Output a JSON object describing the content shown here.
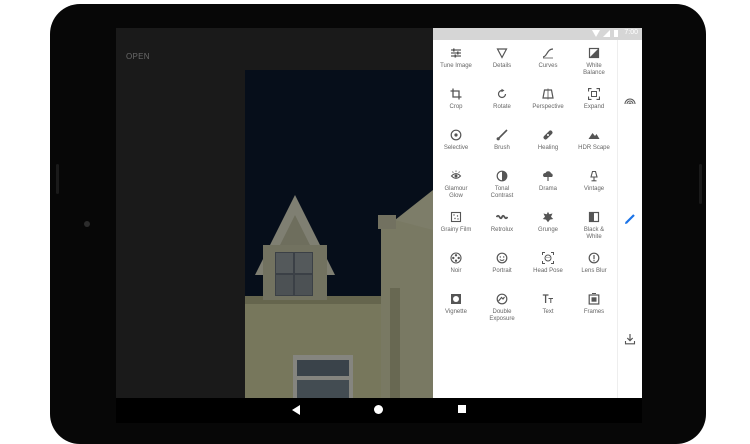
{
  "app": {
    "open_label": "OPEN"
  },
  "status_bar": {
    "time": "7:00"
  },
  "tools": [
    {
      "label": "Tune Image",
      "icon": "tune-icon"
    },
    {
      "label": "Details",
      "icon": "details-icon"
    },
    {
      "label": "Curves",
      "icon": "curves-icon"
    },
    {
      "label": "White\nBalance",
      "icon": "white-balance-icon"
    },
    {
      "label": "Crop",
      "icon": "crop-icon"
    },
    {
      "label": "Rotate",
      "icon": "rotate-icon"
    },
    {
      "label": "Perspective",
      "icon": "perspective-icon"
    },
    {
      "label": "Expand",
      "icon": "expand-icon"
    },
    {
      "label": "Selective",
      "icon": "selective-icon"
    },
    {
      "label": "Brush",
      "icon": "brush-icon"
    },
    {
      "label": "Healing",
      "icon": "healing-icon"
    },
    {
      "label": "HDR Scape",
      "icon": "hdr-scape-icon"
    },
    {
      "label": "Glamour\nGlow",
      "icon": "glamour-glow-icon"
    },
    {
      "label": "Tonal\nContrast",
      "icon": "tonal-contrast-icon"
    },
    {
      "label": "Drama",
      "icon": "drama-icon"
    },
    {
      "label": "Vintage",
      "icon": "vintage-icon"
    },
    {
      "label": "Grainy Film",
      "icon": "grainy-film-icon"
    },
    {
      "label": "Retrolux",
      "icon": "retrolux-icon"
    },
    {
      "label": "Grunge",
      "icon": "grunge-icon"
    },
    {
      "label": "Black &\nWhite",
      "icon": "black-white-icon"
    },
    {
      "label": "Noir",
      "icon": "noir-icon"
    },
    {
      "label": "Portrait",
      "icon": "portrait-icon"
    },
    {
      "label": "Head Pose",
      "icon": "head-pose-icon"
    },
    {
      "label": "Lens Blur",
      "icon": "lens-blur-icon"
    },
    {
      "label": "Vignette",
      "icon": "vignette-icon"
    },
    {
      "label": "Double\nExposure",
      "icon": "double-exposure-icon"
    },
    {
      "label": "Text",
      "icon": "text-icon"
    },
    {
      "label": "Frames",
      "icon": "frames-icon"
    }
  ],
  "side_rail": {
    "looks_icon": "looks-icon",
    "tools_icon": "pencil-icon",
    "export_icon": "download-icon"
  },
  "colors": {
    "accent": "#1a73e8",
    "icon": "#555555",
    "label": "#666666"
  }
}
